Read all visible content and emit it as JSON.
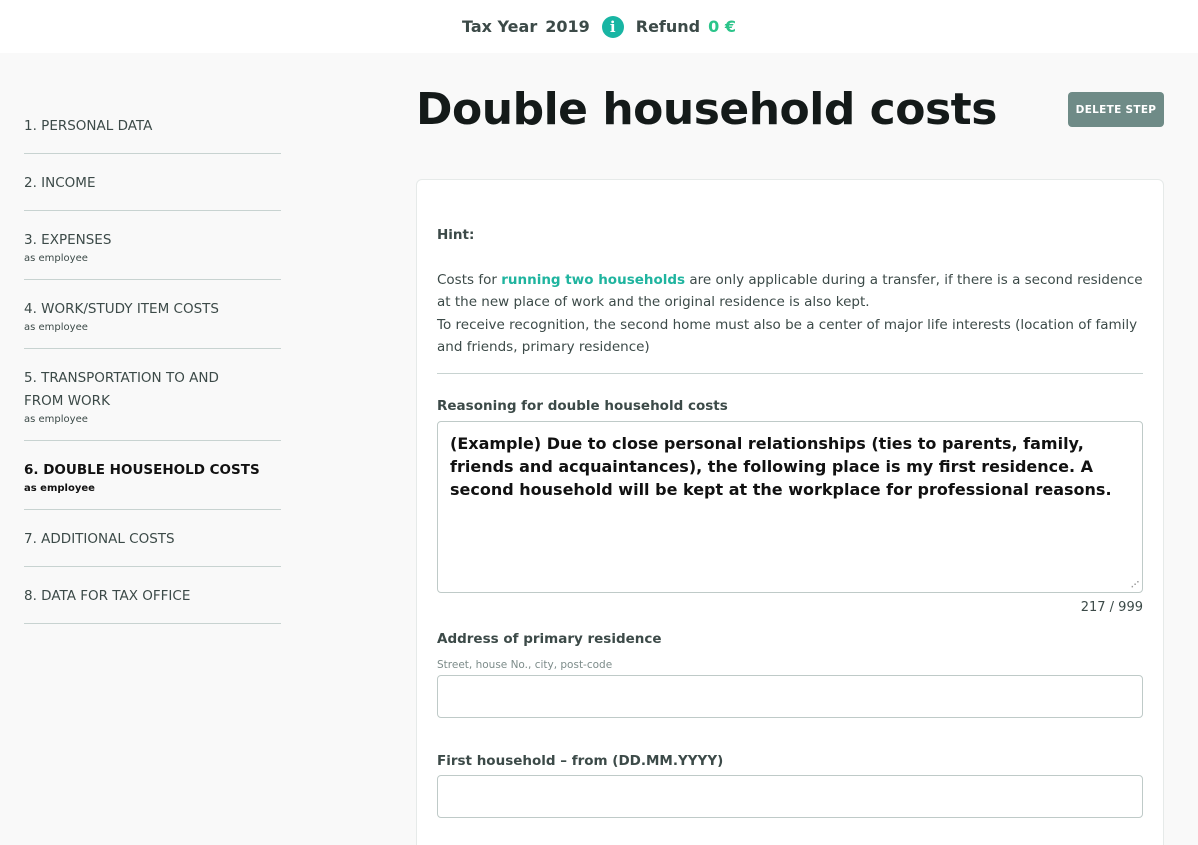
{
  "header": {
    "tax_year_label": "Tax Year",
    "tax_year_value": "2019",
    "info_icon": "info-icon",
    "refund_label": "Refund",
    "refund_value": "0 €",
    "refund_color": "#2bc48a"
  },
  "sidebar": {
    "items": [
      {
        "label": "1. PERSONAL DATA",
        "sub": ""
      },
      {
        "label": "2. INCOME",
        "sub": ""
      },
      {
        "label": "3. EXPENSES",
        "sub": "as employee"
      },
      {
        "label": "4. WORK/STUDY ITEM COSTS",
        "sub": "as employee"
      },
      {
        "label": "5. TRANSPORTATION TO AND FROM WORK",
        "sub": "as employee"
      },
      {
        "label": "6. DOUBLE HOUSEHOLD COSTS",
        "sub": "as employee"
      },
      {
        "label": "7. ADDITIONAL COSTS",
        "sub": ""
      },
      {
        "label": "8. DATA FOR TAX OFFICE",
        "sub": ""
      }
    ],
    "active_index": 5
  },
  "main": {
    "title": "Double household costs",
    "delete_button": "DELETE STEP",
    "hint": {
      "heading": "Hint:",
      "text_before": "Costs for ",
      "link": "running two households",
      "text_after": " are only applicable during a transfer, if there is a second residence at the new place of work and the original residence is also kept.",
      "text_second": "To receive recognition, the second home must also be a center of major life interests (location of family and friends, primary residence)"
    },
    "reasoning": {
      "label": "Reasoning for double household costs",
      "value": "(Example) Due to close personal relationships (ties to parents, family, friends and acquaintances), the following place is my first residence. A second household will be kept at the workplace for professional reasons.",
      "counter": "217 / 999"
    },
    "address": {
      "label": "Address of primary residence",
      "sublabel": "Street, house No., city, post-code",
      "value": ""
    },
    "first_household": {
      "label": "First household – from (DD.MM.YYYY)",
      "value": ""
    }
  },
  "colors": {
    "accent": "#18b5a3",
    "link": "#1fb49f",
    "button": "#6f8b87"
  }
}
